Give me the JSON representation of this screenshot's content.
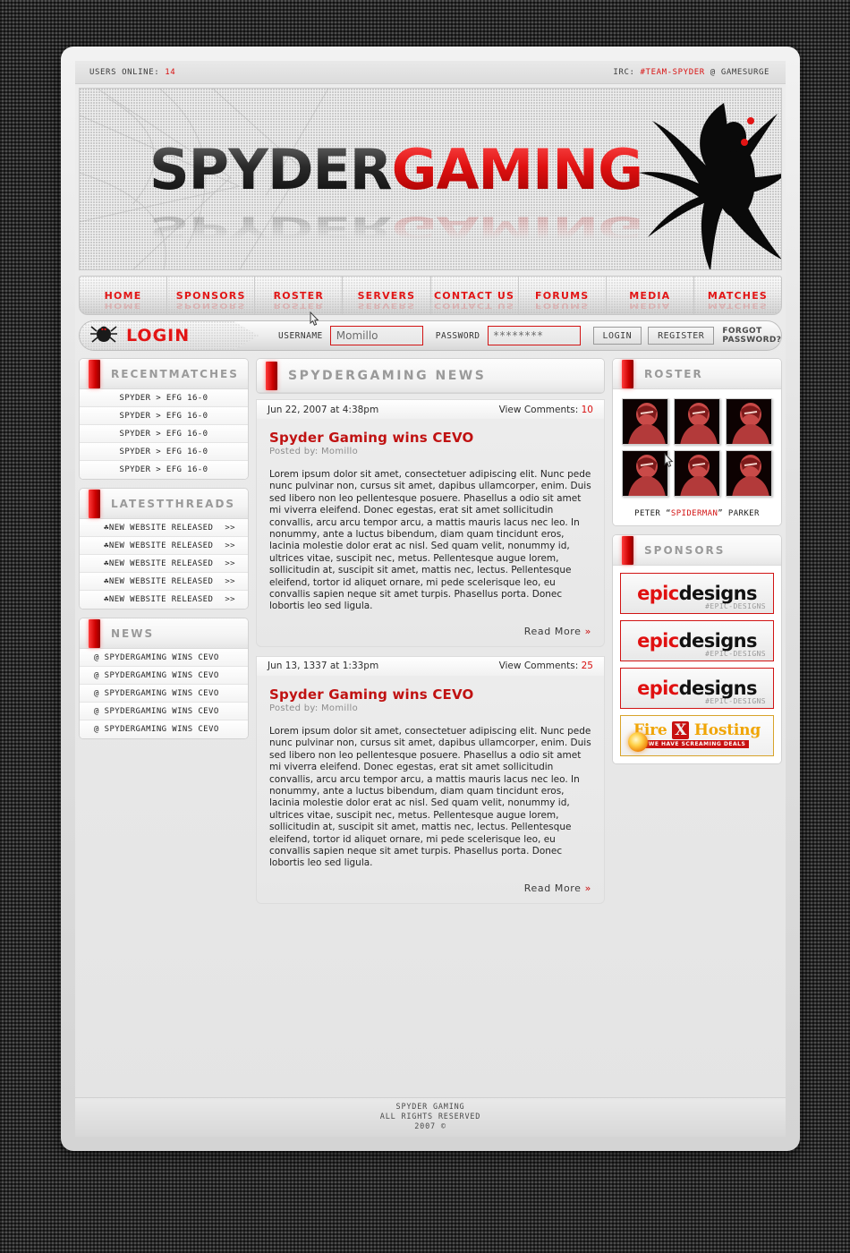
{
  "topbar": {
    "users_label": "USERS ONLINE:",
    "users_count": "14",
    "irc_prefix": "IRC:",
    "irc_channel": "#TEAM-SPYDER",
    "irc_suffix": "@ GAMESURGE"
  },
  "banner": {
    "logo_part1": "SPYDER",
    "logo_part2": "GAMING"
  },
  "nav": {
    "items": [
      {
        "label": "HOME"
      },
      {
        "label": "SPONSORS"
      },
      {
        "label": "ROSTER"
      },
      {
        "label": "SERVERS"
      },
      {
        "label": "CONTACT US"
      },
      {
        "label": "FORUMS"
      },
      {
        "label": "MEDIA"
      },
      {
        "label": "MATCHES"
      }
    ]
  },
  "login": {
    "title": "LOGIN",
    "username_label": "USERNAME",
    "username_value": "Momillo",
    "password_label": "PASSWORD",
    "password_value": "********",
    "login_button": "LOGIN",
    "register_button": "REGISTER",
    "forgot_link": "FORGOT PASSWORD?"
  },
  "recent_matches": {
    "title": "RECENTMATCHES",
    "rows": [
      "SPYDER > EFG 16-0",
      "SPYDER > EFG 16-0",
      "SPYDER > EFG 16-0",
      "SPYDER > EFG 16-0",
      "SPYDER > EFG 16-0"
    ]
  },
  "latest_threads": {
    "title": "LATESTTHREADS",
    "bullet": "☘",
    "chevron": ">>",
    "rows": [
      "NEW WEBSITE RELEASED",
      "NEW WEBSITE RELEASED",
      "NEW WEBSITE RELEASED",
      "NEW WEBSITE RELEASED",
      "NEW WEBSITE RELEASED"
    ]
  },
  "news_list": {
    "title": "NEWS",
    "rows": [
      "@ SPYDERGAMING WINS CEVO",
      "@ SPYDERGAMING WINS CEVO",
      "@ SPYDERGAMING WINS CEVO",
      "@ SPYDERGAMING WINS CEVO",
      "@ SPYDERGAMING WINS CEVO"
    ]
  },
  "news": {
    "title": "SPYDERGAMING NEWS",
    "comments_label": "View Comments:",
    "read_more": "Read More",
    "read_more_chevron": "»",
    "articles": [
      {
        "date": "Jun 22, 2007 at 4:38pm",
        "comments": "10",
        "title": "Spyder Gaming wins CEVO",
        "posted_by": "Posted by: Momillo",
        "body": "Lorem ipsum dolor sit amet, consectetuer adipiscing elit. Nunc pede nunc pulvinar non, cursus sit amet, dapibus ullamcorper, enim. Duis sed libero non leo pellentesque posuere. Phasellus a odio sit amet mi viverra eleifend. Donec egestas, erat sit amet sollicitudin convallis, arcu arcu tempor arcu, a mattis mauris lacus nec leo. In nonummy, ante a luctus bibendum, diam quam tincidunt eros, lacinia molestie dolor erat ac nisl. Sed quam velit, nonummy id, ultrices vitae, suscipit nec, metus. Pellentesque augue lorem, sollicitudin at, suscipit sit amet, mattis nec, lectus. Pellentesque eleifend, tortor id aliquet ornare, mi pede scelerisque leo, eu convallis sapien neque sit amet turpis. Phasellus porta. Donec lobortis leo sed ligula."
      },
      {
        "date": "Jun 13, 1337 at 1:33pm",
        "comments": "25",
        "title": "Spyder Gaming wins CEVO",
        "posted_by": "Posted by: Momillo",
        "body": "Lorem ipsum dolor sit amet, consectetuer adipiscing elit. Nunc pede nunc pulvinar non, cursus sit amet, dapibus ullamcorper, enim. Duis sed libero non leo pellentesque posuere. Phasellus a odio sit amet mi viverra eleifend. Donec egestas, erat sit amet sollicitudin convallis, arcu arcu tempor arcu, a mattis mauris lacus nec leo. In nonummy, ante a luctus bibendum, diam quam tincidunt eros, lacinia molestie dolor erat ac nisl. Sed quam velit, nonummy id, ultrices vitae, suscipit nec, metus. Pellentesque augue lorem, sollicitudin at, suscipit sit amet, mattis nec, lectus. Pellentesque eleifend, tortor id aliquet ornare, mi pede scelerisque leo, eu convallis sapien neque sit amet turpis. Phasellus porta. Donec lobortis leo sed ligula."
      }
    ]
  },
  "roster": {
    "title": "ROSTER",
    "thumb_count": 6,
    "caption_pre": "PETER “",
    "caption_nick": "SPIDERMAN",
    "caption_post": "” PARKER"
  },
  "sponsors": {
    "title": "SPONSORS",
    "items": [
      {
        "type": "epic",
        "name_a": "epic",
        "name_b": "designs",
        "sub": "#EPIC-DESIGNS"
      },
      {
        "type": "epic",
        "name_a": "epic",
        "name_b": "designs",
        "sub": "#EPIC-DESIGNS"
      },
      {
        "type": "epic",
        "name_a": "epic",
        "name_b": "designs",
        "sub": "#EPIC-DESIGNS"
      },
      {
        "type": "fire",
        "word1": "Fire",
        "word2": "X",
        "word3": "Hosting",
        "sub": "WE HAVE SCREAMING DEALS"
      }
    ]
  },
  "footer": {
    "line1": "SPYDER GAMING",
    "line2": "ALL RIGHTS RESERVED",
    "line3": "2007 ©"
  },
  "colors": {
    "accent_red": "#d81111",
    "header_gray": "#9a9a9a"
  }
}
